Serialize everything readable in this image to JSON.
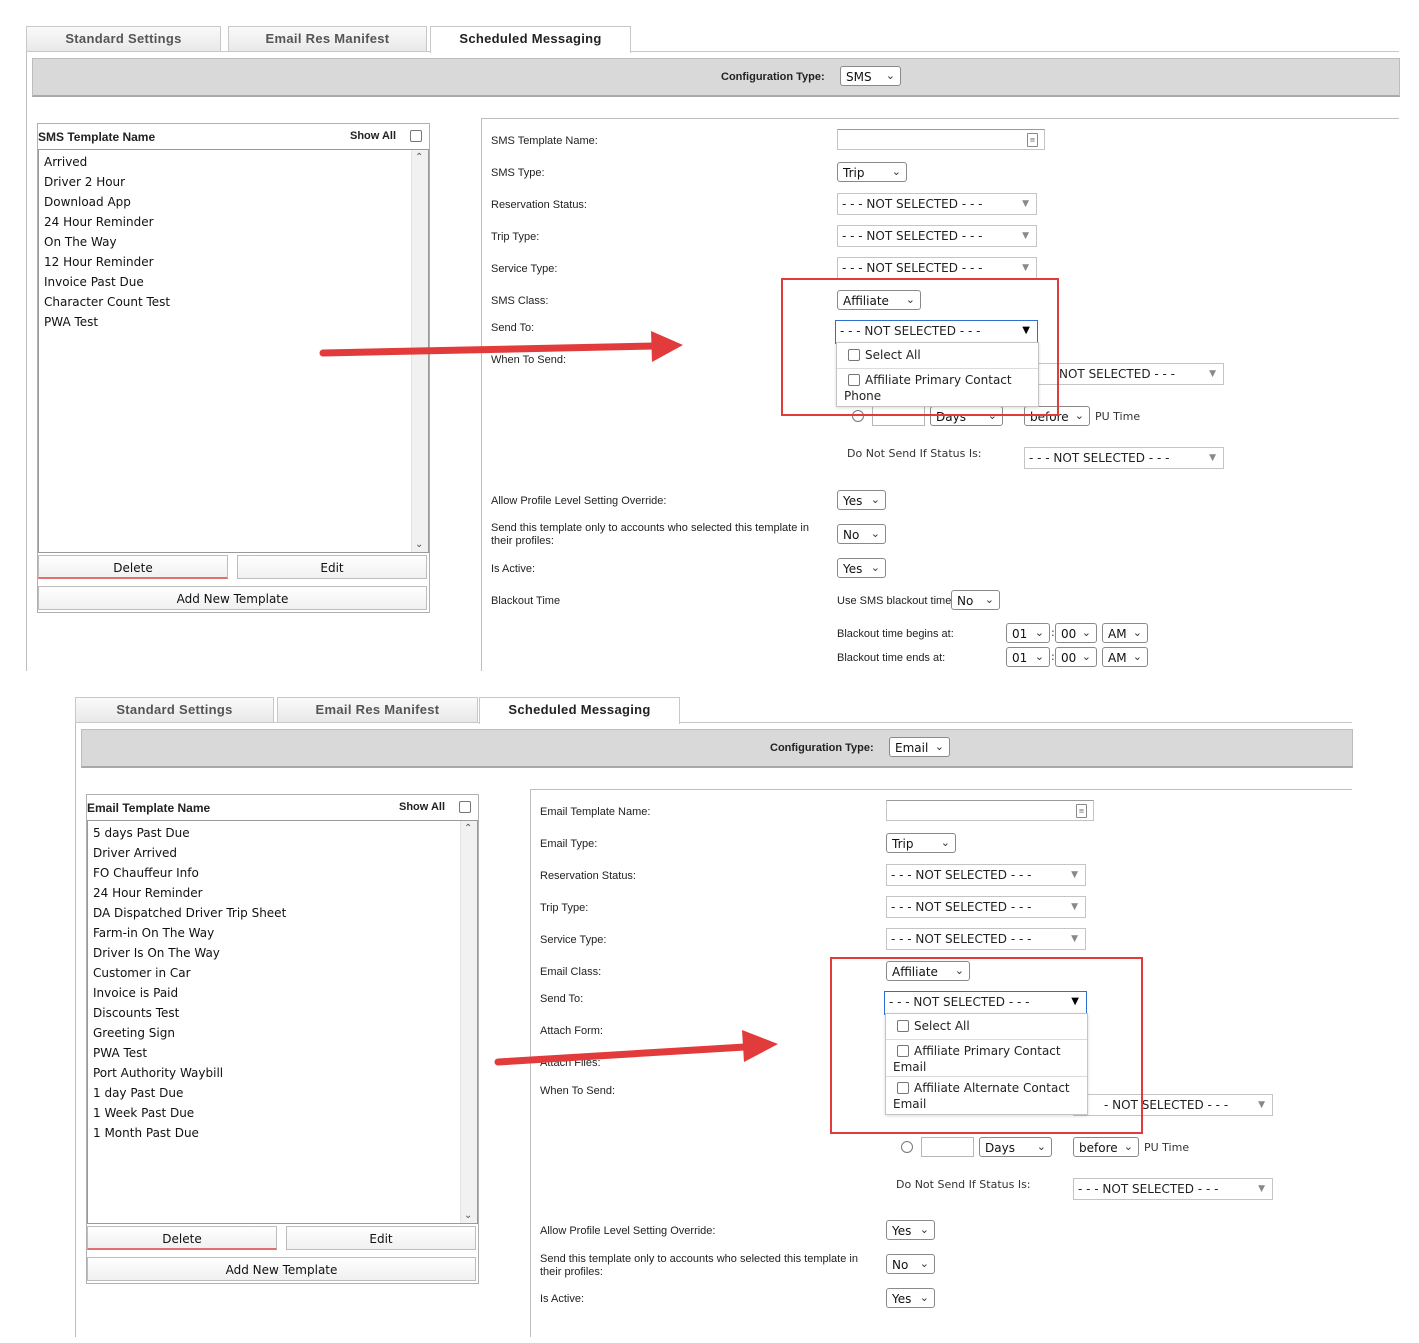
{
  "colors": {
    "accent_red": "#e23b3b",
    "focus_blue": "#2f6fd1"
  },
  "top": {
    "tabs": [
      "Standard Settings",
      "Email Res Manifest",
      "Scheduled Messaging"
    ],
    "config_label": "Configuration Type:",
    "config_value": "SMS",
    "list_header": "SMS Template Name",
    "show_all": "Show All",
    "templates": [
      "Arrived",
      "Driver 2 Hour",
      "Download App",
      "24 Hour Reminder",
      "On The Way",
      "12 Hour Reminder",
      "Invoice Past Due",
      "Character Count Test",
      "PWA Test"
    ],
    "delete": "Delete",
    "edit": "Edit",
    "add_new": "Add New Template",
    "form": {
      "template_name_label": "SMS Template Name:",
      "type_label": "SMS Type:",
      "type_value": "Trip",
      "res_status_label": "Reservation Status:",
      "trip_type_label": "Trip Type:",
      "service_type_label": "Service Type:",
      "class_label": "SMS Class:",
      "class_value": "Affiliate",
      "send_to_label": "Send To:",
      "when_to_send_label": "When To Send:",
      "not_selected": "- - - NOT SELECTED - - -",
      "not_selected_partial": "NOT SELECTED - - -",
      "days": "Days",
      "before": "before",
      "pu_time": "PU Time",
      "do_not_send": "Do Not Send If Status Is:",
      "allow_override_label": "Allow Profile Level Setting Override:",
      "allow_override_value": "Yes",
      "only_accounts_label": "Send this template only to accounts who selected this template in their profiles:",
      "only_accounts_value": "No",
      "is_active_label": "Is Active:",
      "is_active_value": "Yes",
      "blackout_label": "Blackout Time",
      "use_blackout_label": "Use SMS blackout time:",
      "use_blackout_value": "No",
      "begins_label": "Blackout time begins at:",
      "ends_label": "Blackout time ends at:",
      "hour": "01",
      "minute": "00",
      "ampm": "AM"
    },
    "popup": {
      "select_all": "Select All",
      "opt1_line1": "Affiliate Primary Contact",
      "opt1_line2": "Phone"
    }
  },
  "bottom": {
    "tabs": [
      "Standard Settings",
      "Email Res Manifest",
      "Scheduled Messaging"
    ],
    "config_label": "Configuration Type:",
    "config_value": "Email",
    "list_header": "Email Template Name",
    "show_all": "Show All",
    "templates": [
      "5 days Past Due",
      "Driver Arrived",
      "FO Chauffeur Info",
      "24 Hour Reminder",
      "DA Dispatched Driver Trip Sheet",
      "Farm-in On The Way",
      "Driver Is On The Way",
      "Customer in Car",
      "Invoice is Paid",
      "Discounts Test",
      "Greeting Sign",
      "PWA Test",
      "Port Authority Waybill",
      "1 day Past Due",
      "1 Week Past Due",
      "1 Month Past Due"
    ],
    "delete": "Delete",
    "edit": "Edit",
    "add_new": "Add New Template",
    "form": {
      "template_name_label": "Email Template Name:",
      "type_label": "Email Type:",
      "type_value": "Trip",
      "res_status_label": "Reservation Status:",
      "trip_type_label": "Trip Type:",
      "service_type_label": "Service Type:",
      "class_label": "Email Class:",
      "class_value": "Affiliate",
      "send_to_label": "Send To:",
      "attach_form_label": "Attach Form:",
      "attach_files_label": "Attach Files:",
      "when_to_send_label": "When To Send:",
      "not_selected": "- - - NOT SELECTED - - -",
      "not_selected_partial": "- NOT SELECTED - - -",
      "days": "Days",
      "before": "before",
      "pu_time": "PU Time",
      "do_not_send": "Do Not Send If Status Is:",
      "allow_override_label": "Allow Profile Level Setting Override:",
      "allow_override_value": "Yes",
      "only_accounts_label": "Send this template only to accounts who selected this template in their profiles:",
      "only_accounts_value": "No",
      "is_active_label": "Is Active:",
      "is_active_value": "Yes"
    },
    "popup": {
      "select_all": "Select All",
      "opt1_line1": "Affiliate Primary Contact",
      "opt1_line2": "Email",
      "opt2_line1": "Affiliate Alternate Contact",
      "opt2_line2": "Email"
    }
  }
}
